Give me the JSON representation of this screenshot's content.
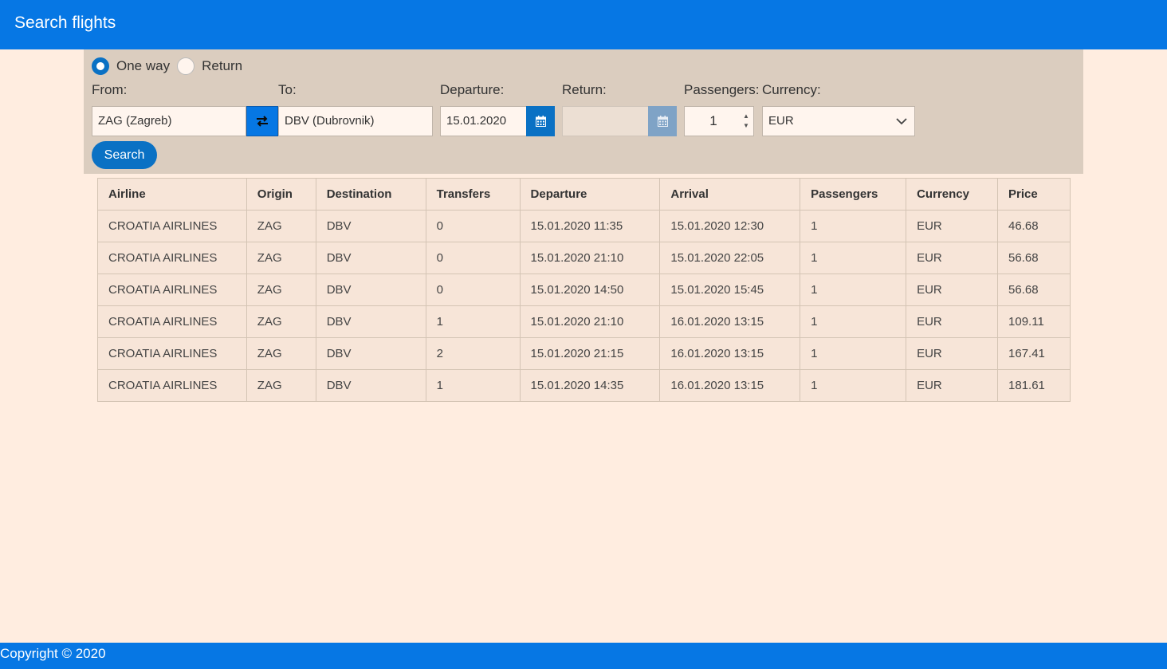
{
  "header": {
    "title": "Search flights"
  },
  "trip_type": {
    "options": [
      {
        "label": "One way",
        "checked": true
      },
      {
        "label": "Return",
        "checked": false
      }
    ]
  },
  "form": {
    "from_label": "From:",
    "from_value": "ZAG (Zagreb)",
    "to_label": "To:",
    "to_value": "DBV (Dubrovnik)",
    "departure_label": "Departure:",
    "departure_value": "15.01.2020",
    "return_label": "Return:",
    "return_value": "",
    "passengers_label": "Passengers:",
    "passengers_value": "1",
    "currency_label": "Currency:",
    "currency_value": "EUR",
    "search_label": "Search"
  },
  "table": {
    "headers": [
      "Airline",
      "Origin",
      "Destination",
      "Transfers",
      "Departure",
      "Arrival",
      "Passengers",
      "Currency",
      "Price"
    ],
    "rows": [
      [
        "CROATIA AIRLINES",
        "ZAG",
        "DBV",
        "0",
        "15.01.2020 11:35",
        "15.01.2020 12:30",
        "1",
        "EUR",
        "46.68"
      ],
      [
        "CROATIA AIRLINES",
        "ZAG",
        "DBV",
        "0",
        "15.01.2020 21:10",
        "15.01.2020 22:05",
        "1",
        "EUR",
        "56.68"
      ],
      [
        "CROATIA AIRLINES",
        "ZAG",
        "DBV",
        "0",
        "15.01.2020 14:50",
        "15.01.2020 15:45",
        "1",
        "EUR",
        "56.68"
      ],
      [
        "CROATIA AIRLINES",
        "ZAG",
        "DBV",
        "1",
        "15.01.2020 21:10",
        "16.01.2020 13:15",
        "1",
        "EUR",
        "109.11"
      ],
      [
        "CROATIA AIRLINES",
        "ZAG",
        "DBV",
        "2",
        "15.01.2020 21:15",
        "16.01.2020 13:15",
        "1",
        "EUR",
        "167.41"
      ],
      [
        "CROATIA AIRLINES",
        "ZAG",
        "DBV",
        "1",
        "15.01.2020 14:35",
        "16.01.2020 13:15",
        "1",
        "EUR",
        "181.61"
      ]
    ]
  },
  "footer": {
    "copyright": "Copyright © 2020"
  },
  "colors": {
    "primary": "#0677e4",
    "accent": "#0a71c4",
    "background": "#ffede0",
    "panel": "#dbcdbf"
  },
  "icons": {
    "swap": "swap-arrows-icon",
    "calendar": "calendar-icon",
    "chevron": "chevron-down-icon"
  }
}
